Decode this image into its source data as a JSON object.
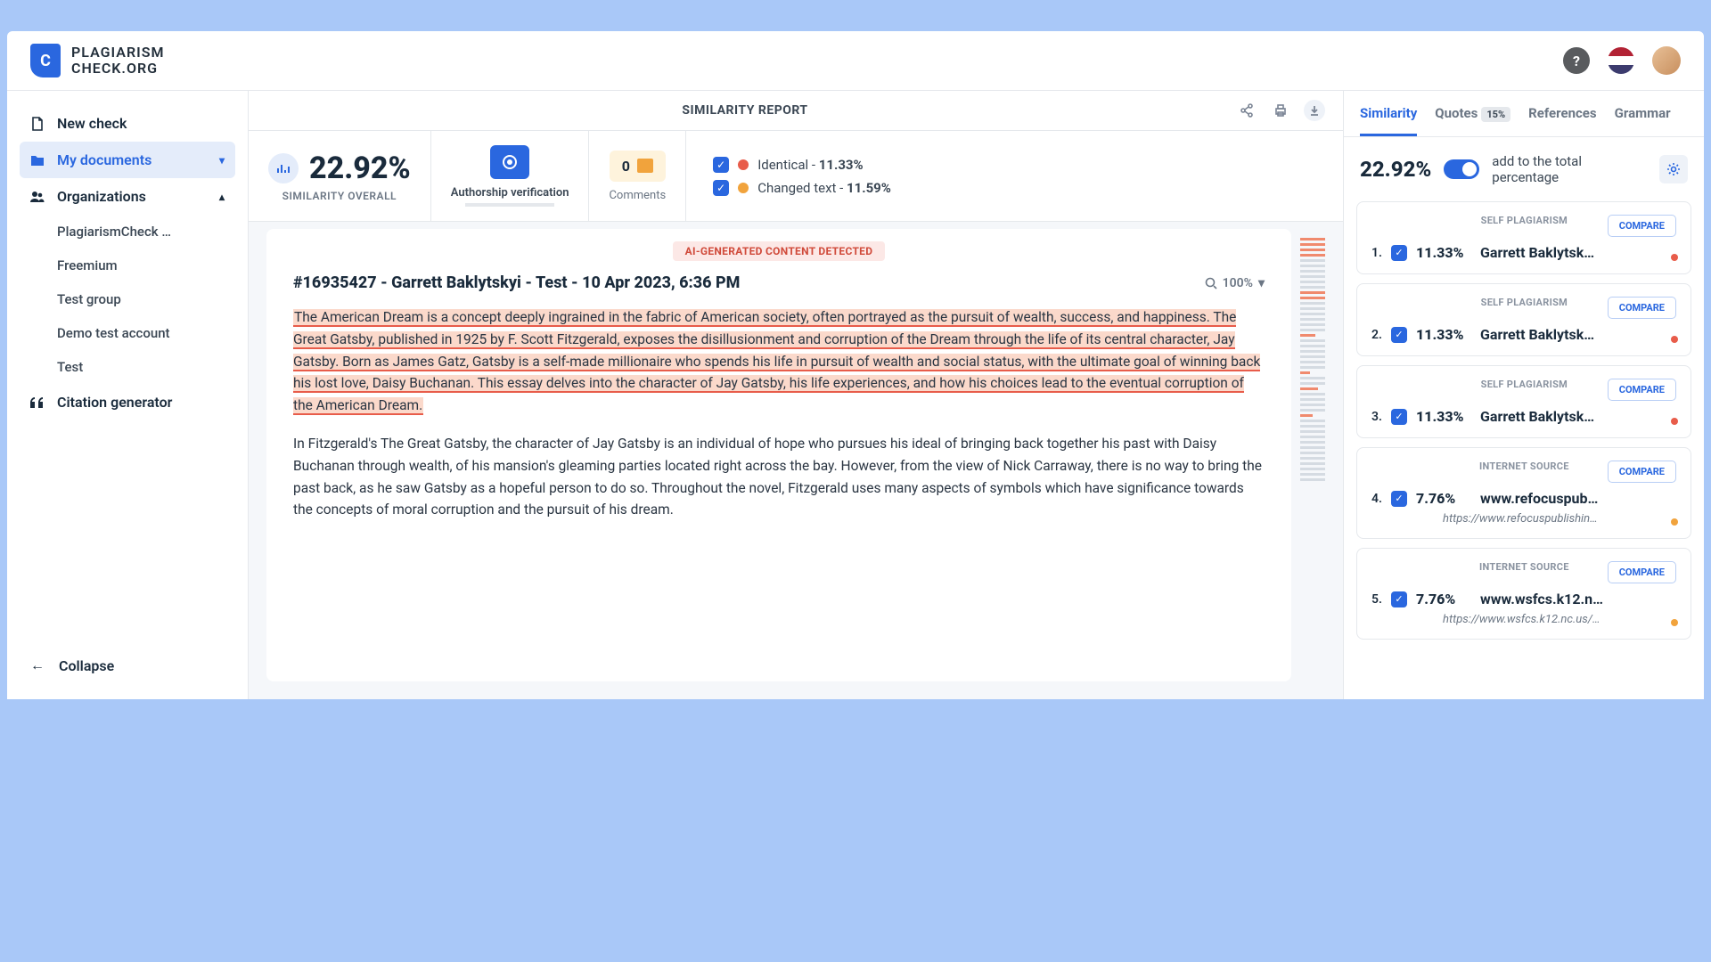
{
  "brand": {
    "line1": "PLAGIARISM",
    "line2": "CHECK.ORG"
  },
  "sidebar": {
    "new_check": "New check",
    "my_docs": "My documents",
    "orgs": "Organizations",
    "org_items": [
      "PlagiarismCheck …",
      "Freemium",
      "Test group",
      "Demo test account",
      "Test"
    ],
    "citation": "Citation generator",
    "collapse": "Collapse"
  },
  "report": {
    "title": "SIMILARITY REPORT",
    "similarity_value": "22.92%",
    "similarity_label": "SIMILARITY OVERALL",
    "authorship": "Authorship verification",
    "comments_count": "0",
    "comments_label": "Comments",
    "identical_label": "Identical - ",
    "identical_pct": "11.33%",
    "changed_label": "Changed text - ",
    "changed_pct": "11.59%",
    "ai_banner": "AI-GENERATED CONTENT DETECTED",
    "doc_title": "#16935427 - Garrett Baklytskyi - Test - 10 Apr 2023, 6:36 PM",
    "zoom": "100%",
    "para1": "The American Dream is a concept deeply ingrained in the fabric of American society, often portrayed as the pursuit of wealth, success, and happiness. The Great Gatsby, published in 1925 by F. Scott Fitzgerald, exposes the disillusionment and corruption of the Dream through the life of its central character, Jay Gatsby. Born as James Gatz, Gatsby is a self-made millionaire who spends his life in pursuit of wealth and social status, with the ultimate goal of winning back his lost love, Daisy Buchanan. This essay delves into the character of Jay Gatsby, his life experiences, and how his choices lead to the eventual corruption of the American Dream.",
    "para2": "In Fitzgerald's The Great Gatsby, the character of Jay Gatsby is an individual of hope who pursues his ideal of bringing back together his past with Daisy Buchanan through wealth, of his mansion's gleaming parties located right across the bay. However, from the view of Nick Carraway, there is no way to bring the past back, as he saw Gatsby as a hopeful person to do so. Throughout the novel, Fitzgerald uses many aspects of symbols which have significance towards the concepts of moral corruption and the pursuit of his dream."
  },
  "tabs": {
    "similarity": "Similarity",
    "quotes": "Quotes",
    "quotes_badge": "15%",
    "references": "References",
    "grammar": "Grammar"
  },
  "panel": {
    "pct": "22.92%",
    "add_label": "add to the total percentage",
    "compare": "COMPARE",
    "self_tag": "SELF PLAGIARISM",
    "internet_tag": "INTERNET SOURCE",
    "sources": [
      {
        "num": "1.",
        "pct": "11.33%",
        "name": "Garrett Baklytsk…",
        "tag": "self"
      },
      {
        "num": "2.",
        "pct": "11.33%",
        "name": "Garrett Baklytsk…",
        "tag": "self"
      },
      {
        "num": "3.",
        "pct": "11.33%",
        "name": "Garrett Baklytsk…",
        "tag": "self"
      },
      {
        "num": "4.",
        "pct": "7.76%",
        "name": "www.refocuspub…",
        "tag": "internet",
        "url": "https://www.refocuspublishin…"
      },
      {
        "num": "5.",
        "pct": "7.76%",
        "name": "www.wsfcs.k12.n…",
        "tag": "internet",
        "url": "https://www.wsfcs.k12.nc.us/…"
      }
    ]
  }
}
